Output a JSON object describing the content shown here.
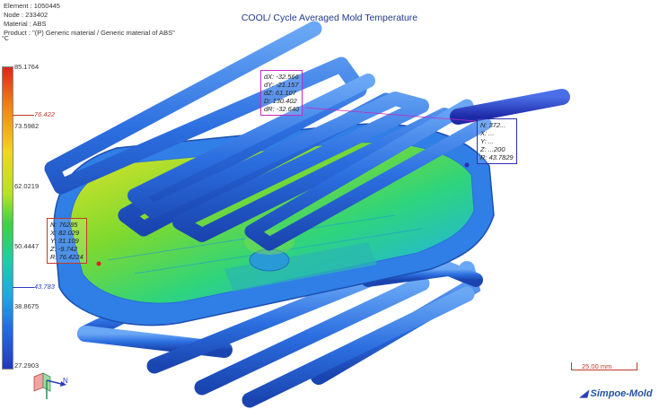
{
  "header": {
    "element": "Element : 1050445",
    "node": "Node : 233402",
    "material": "Material : ABS",
    "product": "Product : \"(P) Generic material / Generic material of ABS\""
  },
  "title": "COOL/ Cycle Averaged Mold Temperature",
  "legend": {
    "unit": "°C",
    "ticks": [
      "85.1764",
      "73.5982",
      "62.0219",
      "50.4447",
      "38.8675",
      "27.2903"
    ],
    "marker_high": "76.422",
    "marker_low": "43.783",
    "marker_high_color": "#c0392b",
    "marker_low_color": "#2b3fb8"
  },
  "probes": {
    "distance": [
      "dX: -32.566",
      "dY: -21.157",
      "dZ: 61.107",
      "D: 130.402",
      "dR: -32.640"
    ],
    "right": [
      "N: 372...",
      "X: ...",
      "Y: ...",
      "Z: ...200",
      "R: 43.7829"
    ],
    "left": [
      "N: 76285",
      "X: 82.029",
      "Y: 31.109",
      "Z: -9.742",
      "R: 76.4224"
    ],
    "distance_color": "#c429c4",
    "right_color": "#2b2fb0",
    "left_color": "#c0392b"
  },
  "axis": {
    "n_label": "N"
  },
  "scale_bar": "25.00 mm",
  "logo": "Simpoe-Mold"
}
